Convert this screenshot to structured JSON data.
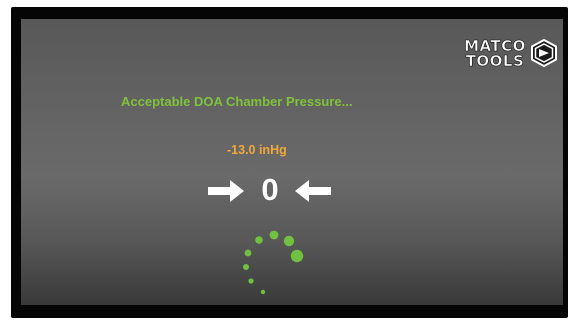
{
  "brand": {
    "line1": "MATCO",
    "line2": "TOOLS"
  },
  "status_message": "Acceptable DOA Chamber Pressure...",
  "pressure_reading": "-13.0 inHg",
  "target_value": "0",
  "colors": {
    "status_green": "#7fc33a",
    "reading_orange": "#f0a83a",
    "spinner_green": "#6ec23e"
  },
  "icons": {
    "left": "right-arrow-icon",
    "right": "left-arrow-icon",
    "loader": "loading-spinner-icon"
  }
}
